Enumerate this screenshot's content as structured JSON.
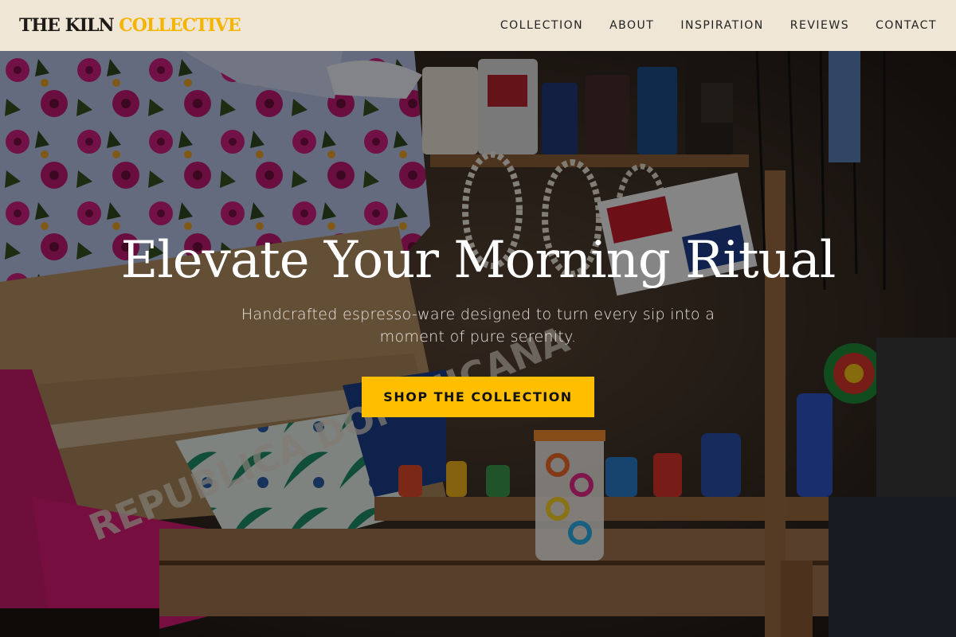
{
  "brand": {
    "name_primary": "THE KILN",
    "name_accent": "COLLECTIVE",
    "accent_color": "#ffbf00"
  },
  "nav": {
    "items": [
      {
        "label": "COLLECTION"
      },
      {
        "label": "ABOUT"
      },
      {
        "label": "INSPIRATION"
      },
      {
        "label": "REVIEWS"
      },
      {
        "label": "CONTACT"
      }
    ]
  },
  "hero": {
    "title": "Elevate Your Morning Ritual",
    "subtitle": "Handcrafted espresso-ware designed to turn every sip into a moment of pure serenity.",
    "cta_label": "SHOP THE COLLECTION",
    "background_image": "market stall with souvenirs",
    "background_text": "REPUBLICA DOMINICANA"
  }
}
